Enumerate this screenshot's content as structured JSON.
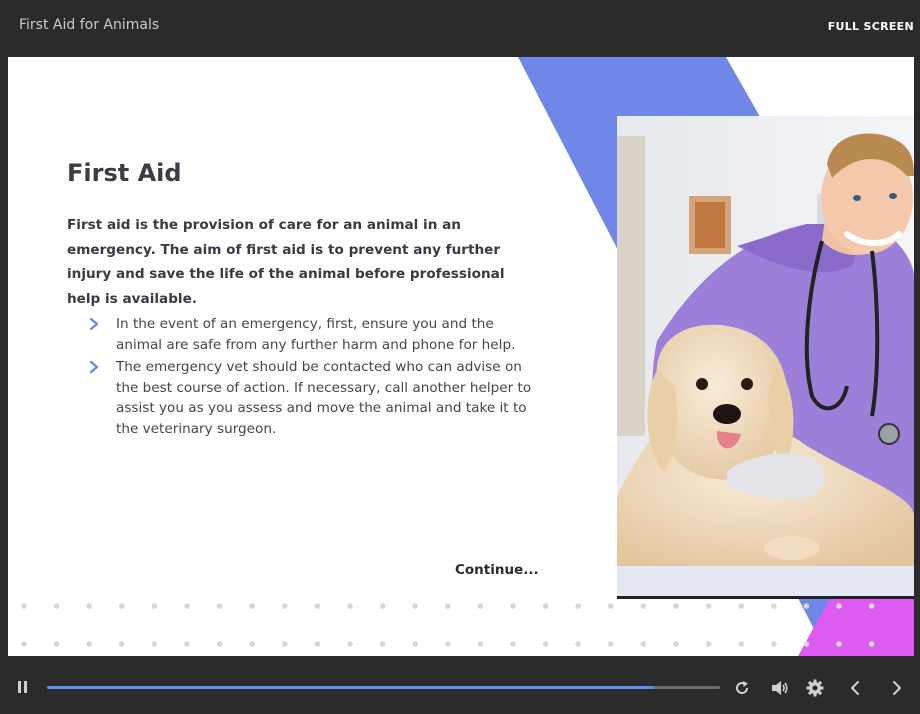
{
  "header": {
    "course_title": "First Aid for Animals",
    "fullscreen_label": "FULL SCREEN"
  },
  "slide": {
    "heading": "First Aid",
    "intro": "First aid is the provision of care for an animal in an emergency. The aim of first aid is to prevent any further injury and save the life of the animal before professional help is available.",
    "bullets": [
      "In the event of an emergency, first, ensure you and the animal are safe from any further harm and phone for help.",
      "The emergency vet should be contacted who can advise on the best course of action. If necessary, call another helper to assist you as you assess and move the animal and take it to the veterinary surgeon."
    ],
    "continue_label": "Continue...",
    "accent_blue": "#6f87e6",
    "accent_pink": "#dc5cf1",
    "chevron_color": "#6f87e6"
  },
  "player": {
    "progress": 0.902,
    "progress_color": "#5b8ff0",
    "icons": [
      "pause-icon",
      "replay-icon",
      "volume-icon",
      "settings-icon",
      "previous-icon",
      "next-icon"
    ]
  }
}
